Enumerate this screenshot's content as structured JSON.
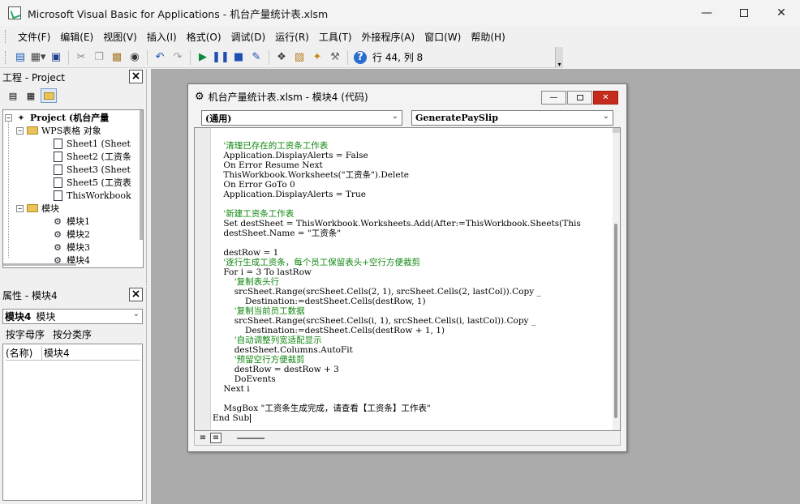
{
  "window": {
    "title": "Microsoft Visual Basic for Applications - 机台产量统计表.xlsm",
    "minimize_icon": "minimize-icon",
    "maximize_icon": "maximize-icon",
    "close_icon": "close-icon"
  },
  "menu": [
    "文件(F)",
    "编辑(E)",
    "视图(V)",
    "插入(I)",
    "格式(O)",
    "调试(D)",
    "运行(R)",
    "工具(T)",
    "外接程序(A)",
    "窗口(W)",
    "帮助(H)"
  ],
  "toolbar": {
    "cursor_position": "行 44, 列 8",
    "icons": [
      "view-excel-icon",
      "insert-module-icon",
      "save-icon",
      "cut-icon",
      "copy-icon",
      "paste-icon",
      "find-icon",
      "undo-icon",
      "redo-icon",
      "run-icon",
      "break-icon",
      "reset-icon",
      "design-mode-icon",
      "project-explorer-icon",
      "properties-icon",
      "object-browser-icon",
      "toolbox-icon",
      "help-icon"
    ]
  },
  "project_pane": {
    "title": "工程 - Project",
    "tree": {
      "project": "Project (机台产量",
      "objects_folder": "WPS表格 对象",
      "objects": [
        "Sheet1 (Sheet",
        "Sheet2 (工资条",
        "Sheet3 (Sheet",
        "Sheet5 (工资表",
        "ThisWorkbook"
      ],
      "modules_folder": "模块",
      "modules": [
        "模块1",
        "模块2",
        "模块3",
        "模块4"
      ]
    }
  },
  "properties_pane": {
    "title": "属性 - 模块4",
    "object_name": "模块4",
    "object_type": "模块",
    "tabs": [
      "按字母序",
      "按分类序"
    ],
    "rows": [
      {
        "key": "(名称)",
        "value": "模块4"
      }
    ]
  },
  "code_window": {
    "title": "机台产量统计表.xlsm - 模块4 (代码)",
    "object_combo": "(通用)",
    "procedure_combo": "GeneratePaySlip",
    "lines": [
      {
        "text": "",
        "comment": false
      },
      {
        "text": "    '清理已存在的工资条工作表",
        "comment": true
      },
      {
        "text": "    Application.DisplayAlerts = False",
        "comment": false
      },
      {
        "text": "    On Error Resume Next",
        "comment": false
      },
      {
        "text": "    ThisWorkbook.Worksheets(\"工资条\").Delete",
        "comment": false
      },
      {
        "text": "    On Error GoTo 0",
        "comment": false
      },
      {
        "text": "    Application.DisplayAlerts = True",
        "comment": false
      },
      {
        "text": "",
        "comment": false
      },
      {
        "text": "    '新建工资条工作表",
        "comment": true
      },
      {
        "text": "    Set destSheet = ThisWorkbook.Worksheets.Add(After:=ThisWorkbook.Sheets(This",
        "comment": false
      },
      {
        "text": "    destSheet.Name = \"工资条\"",
        "comment": false
      },
      {
        "text": "",
        "comment": false
      },
      {
        "text": "    destRow = 1",
        "comment": false
      },
      {
        "text": "    '逐行生成工资条，每个员工保留表头+空行方便裁剪",
        "comment": true
      },
      {
        "text": "    For i = 3 To lastRow",
        "comment": false
      },
      {
        "text": "        '复制表头行",
        "comment": true
      },
      {
        "text": "        srcSheet.Range(srcSheet.Cells(2, 1), srcSheet.Cells(2, lastCol)).Copy _",
        "comment": false
      },
      {
        "text": "            Destination:=destSheet.Cells(destRow, 1)",
        "comment": false
      },
      {
        "text": "        '复制当前员工数据",
        "comment": true
      },
      {
        "text": "        srcSheet.Range(srcSheet.Cells(i, 1), srcSheet.Cells(i, lastCol)).Copy _",
        "comment": false
      },
      {
        "text": "            Destination:=destSheet.Cells(destRow + 1, 1)",
        "comment": false
      },
      {
        "text": "        '自动调整列宽适配显示",
        "comment": true
      },
      {
        "text": "        destSheet.Columns.AutoFit",
        "comment": false
      },
      {
        "text": "        '预留空行方便裁剪",
        "comment": true
      },
      {
        "text": "        destRow = destRow + 3",
        "comment": false
      },
      {
        "text": "        DoEvents",
        "comment": false
      },
      {
        "text": "    Next i",
        "comment": false
      },
      {
        "text": "",
        "comment": false
      },
      {
        "text": "    MsgBox \"工资条生成完成，请查看【工资条】工作表\"",
        "comment": false
      },
      {
        "text": "End Sub",
        "comment": false
      }
    ]
  }
}
